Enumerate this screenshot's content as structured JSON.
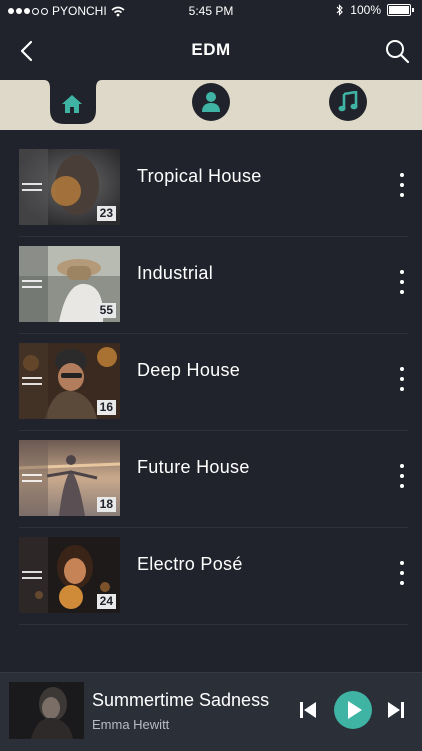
{
  "status": {
    "carrier": "PYONCHI",
    "time": "5:45 PM",
    "battery": "100%"
  },
  "header": {
    "title": "EDM"
  },
  "tabs": [
    {
      "icon": "home-icon",
      "active": true
    },
    {
      "icon": "user-icon",
      "active": false
    },
    {
      "icon": "music-note-icon",
      "active": false
    }
  ],
  "playlists": [
    {
      "title": "Tropical House",
      "count": "23"
    },
    {
      "title": "Industrial",
      "count": "55"
    },
    {
      "title": "Deep House",
      "count": "16"
    },
    {
      "title": "Future House",
      "count": "18"
    },
    {
      "title": "Electro Posé",
      "count": "24"
    }
  ],
  "now_playing": {
    "song": "Summertime Sadness",
    "artist": "Emma Hewitt"
  },
  "colors": {
    "background": "#20232b",
    "tab_bar": "#ded9c9",
    "accent": "#3fb4a4",
    "player_background": "#2b2f38"
  }
}
